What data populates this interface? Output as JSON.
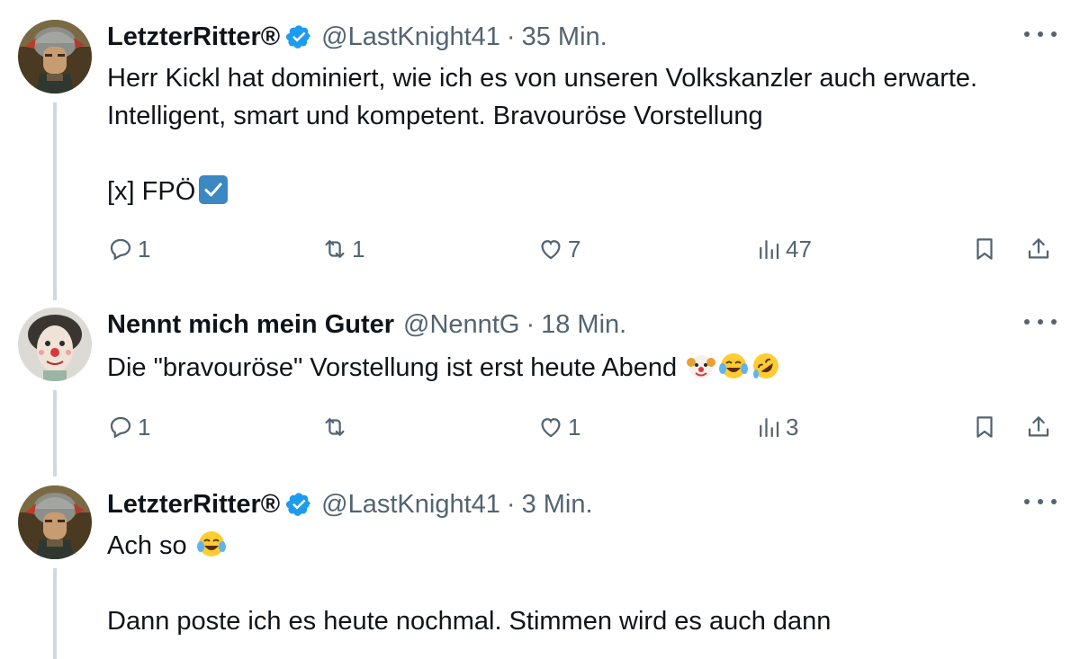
{
  "tweets": [
    {
      "name": "LetzterRitter®",
      "verified": true,
      "handle": "@LastKnight41",
      "separator": "·",
      "time": "35 Min.",
      "avatar_icon": "knight-helmet-painting",
      "lines": [
        "Herr Kickl hat dominiert, wie ich es von unseren Volkskanzler auch erwarte.",
        "Intelligent, smart und kompetent. Bravouröse Vorstellung",
        "",
        "[x] FPÖ"
      ],
      "trailing_emoji": "check-box-with-check",
      "actions": {
        "replies": "1",
        "reposts": "1",
        "likes": "7",
        "views": "47"
      }
    },
    {
      "name": "Nennt mich mein Guter",
      "verified": false,
      "handle": "@NenntG",
      "separator": "·",
      "time": "18 Min.",
      "avatar_icon": "clown-face-photo",
      "lines": [
        "Die \"bravouröse\" Vorstellung ist erst heute Abend"
      ],
      "trailing_emojis": [
        "clown-face",
        "face-with-tears-of-joy",
        "rolling-on-the-floor-laughing"
      ],
      "actions": {
        "replies": "1",
        "reposts": "",
        "likes": "1",
        "views": "3"
      }
    },
    {
      "name": "LetzterRitter®",
      "verified": true,
      "handle": "@LastKnight41",
      "separator": "·",
      "time": "3 Min.",
      "avatar_icon": "knight-helmet-painting",
      "lines": [
        "Ach so",
        "",
        "Dann poste ich es heute nochmal. Stimmen wird es auch dann"
      ],
      "trailing_emoji_line0": "face-with-tears-of-joy"
    }
  ],
  "colors": {
    "text": "#0f1419",
    "secondary": "#536471",
    "verified": "#1d9bf0",
    "thread_line": "#cfd9de"
  }
}
